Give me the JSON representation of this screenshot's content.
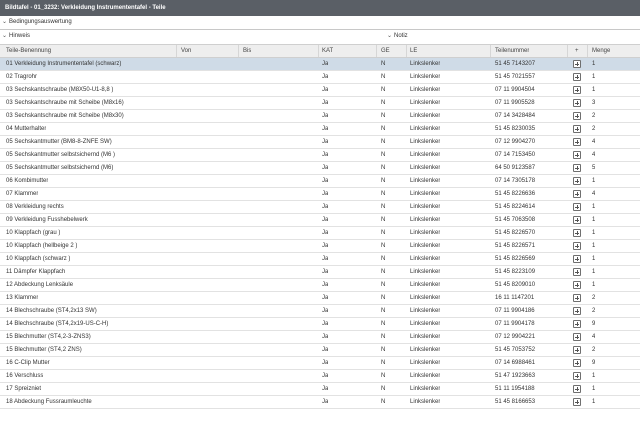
{
  "window": {
    "title": "Bildtafel - 01_3232: Verkleidung Instrumententafel - Teile"
  },
  "sections": {
    "condition": "Bedingungsauswertung",
    "hint": "Hinweis",
    "note": "Notiz"
  },
  "table": {
    "columns": [
      "Teile-Benennung",
      "Von",
      "Bis",
      "KAT",
      "GE",
      "LE",
      "Teilenummer",
      "+",
      "Menge"
    ],
    "rows": [
      {
        "name": "01 Verkleidung Instrumententafel (schwarz)",
        "kat": "Ja",
        "ge": "N",
        "le": "Linkslenker",
        "partno": "51 45 7143207",
        "qty": "1"
      },
      {
        "name": "02 Tragrohr",
        "kat": "Ja",
        "ge": "N",
        "le": "Linkslenker",
        "partno": "51 45 7021557",
        "qty": "1"
      },
      {
        "name": "03 Sechskantschraube (M8X50-U1-8,8 )",
        "kat": "Ja",
        "ge": "N",
        "le": "Linkslenker",
        "partno": "07 11 9904504",
        "qty": "1"
      },
      {
        "name": "03 Sechskantschraube mit Scheibe (M8x16)",
        "kat": "Ja",
        "ge": "N",
        "le": "Linkslenker",
        "partno": "07 11 9905528",
        "qty": "3"
      },
      {
        "name": "03 Sechskantschraube mit Scheibe (M8x30)",
        "kat": "Ja",
        "ge": "N",
        "le": "Linkslenker",
        "partno": "07 14 3428484",
        "qty": "2"
      },
      {
        "name": "04 Mutterhalter",
        "kat": "Ja",
        "ge": "N",
        "le": "Linkslenker",
        "partno": "51 45 8230035",
        "qty": "2"
      },
      {
        "name": "05 Sechskantmutter (BM8-8-ZNFE SW)",
        "kat": "Ja",
        "ge": "N",
        "le": "Linkslenker",
        "partno": "07 12 9904270",
        "qty": "4"
      },
      {
        "name": "05 Sechskantmutter selbstsichernd (M6 )",
        "kat": "Ja",
        "ge": "N",
        "le": "Linkslenker",
        "partno": "07 14 7153450",
        "qty": "4"
      },
      {
        "name": "05 Sechskantmutter selbstsichernd (M6)",
        "kat": "Ja",
        "ge": "N",
        "le": "Linkslenker",
        "partno": "64 50 9123587",
        "qty": "5"
      },
      {
        "name": "06 Kombimutter",
        "kat": "Ja",
        "ge": "N",
        "le": "Linkslenker",
        "partno": "07 14 7305178",
        "qty": "1"
      },
      {
        "name": "07 Klammer",
        "kat": "Ja",
        "ge": "N",
        "le": "Linkslenker",
        "partno": "51 45 8226636",
        "qty": "4"
      },
      {
        "name": "08 Verkleidung rechts",
        "kat": "Ja",
        "ge": "N",
        "le": "Linkslenker",
        "partno": "51 45 8224614",
        "qty": "1"
      },
      {
        "name": "09 Verkleidung Fusshebelwerk",
        "kat": "Ja",
        "ge": "N",
        "le": "Linkslenker",
        "partno": "51 45 7063508",
        "qty": "1"
      },
      {
        "name": "10 Klappfach (grau )",
        "kat": "Ja",
        "ge": "N",
        "le": "Linkslenker",
        "partno": "51 45 8226570",
        "qty": "1"
      },
      {
        "name": "10 Klappfach (hellbeige 2 )",
        "kat": "Ja",
        "ge": "N",
        "le": "Linkslenker",
        "partno": "51 45 8226571",
        "qty": "1"
      },
      {
        "name": "10 Klappfach (schwarz )",
        "kat": "Ja",
        "ge": "N",
        "le": "Linkslenker",
        "partno": "51 45 8226569",
        "qty": "1"
      },
      {
        "name": "11 Dämpfer Klappfach",
        "kat": "Ja",
        "ge": "N",
        "le": "Linkslenker",
        "partno": "51 45 8223109",
        "qty": "1"
      },
      {
        "name": "12 Abdeckung Lenksäule",
        "kat": "Ja",
        "ge": "N",
        "le": "Linkslenker",
        "partno": "51 45 8209010",
        "qty": "1"
      },
      {
        "name": "13 Klammer",
        "kat": "Ja",
        "ge": "N",
        "le": "Linkslenker",
        "partno": "16 11 1147201",
        "qty": "2"
      },
      {
        "name": "14 Blechschraube (ST4,2x13 SW)",
        "kat": "Ja",
        "ge": "N",
        "le": "Linkslenker",
        "partno": "07 11 9904186",
        "qty": "2"
      },
      {
        "name": "14 Blechschraube (ST4,2x19-US-C-H)",
        "kat": "Ja",
        "ge": "N",
        "le": "Linkslenker",
        "partno": "07 11 9904178",
        "qty": "9"
      },
      {
        "name": "15 Blechmutter (ST4,2-3-ZNS3)",
        "kat": "Ja",
        "ge": "N",
        "le": "Linkslenker",
        "partno": "07 12 9904221",
        "qty": "4"
      },
      {
        "name": "15 Blechmutter (ST4,2 ZNS)",
        "kat": "Ja",
        "ge": "N",
        "le": "Linkslenker",
        "partno": "51 45 7053752",
        "qty": "2"
      },
      {
        "name": "16 C-Clip Mutter",
        "kat": "Ja",
        "ge": "N",
        "le": "Linkslenker",
        "partno": "07 14 6988461",
        "qty": "9"
      },
      {
        "name": "16 Verschluss",
        "kat": "Ja",
        "ge": "N",
        "le": "Linkslenker",
        "partno": "51 47 1923663",
        "qty": "1"
      },
      {
        "name": "17 Spreizniet",
        "kat": "Ja",
        "ge": "N",
        "le": "Linkslenker",
        "partno": "51 11 1954188",
        "qty": "1"
      },
      {
        "name": "18 Abdeckung Fussraumleuchte",
        "kat": "Ja",
        "ge": "N",
        "le": "Linkslenker",
        "partno": "51 45 8166653",
        "qty": "1"
      }
    ]
  },
  "colors": {
    "titlebar": "#5a5f66",
    "header_bg": "#eeeeee",
    "selected_row": "#cfdbe7"
  },
  "icons": {
    "section_toggle": "chevron-down-icon",
    "add_to_cart": "add-to-cart-icon"
  }
}
